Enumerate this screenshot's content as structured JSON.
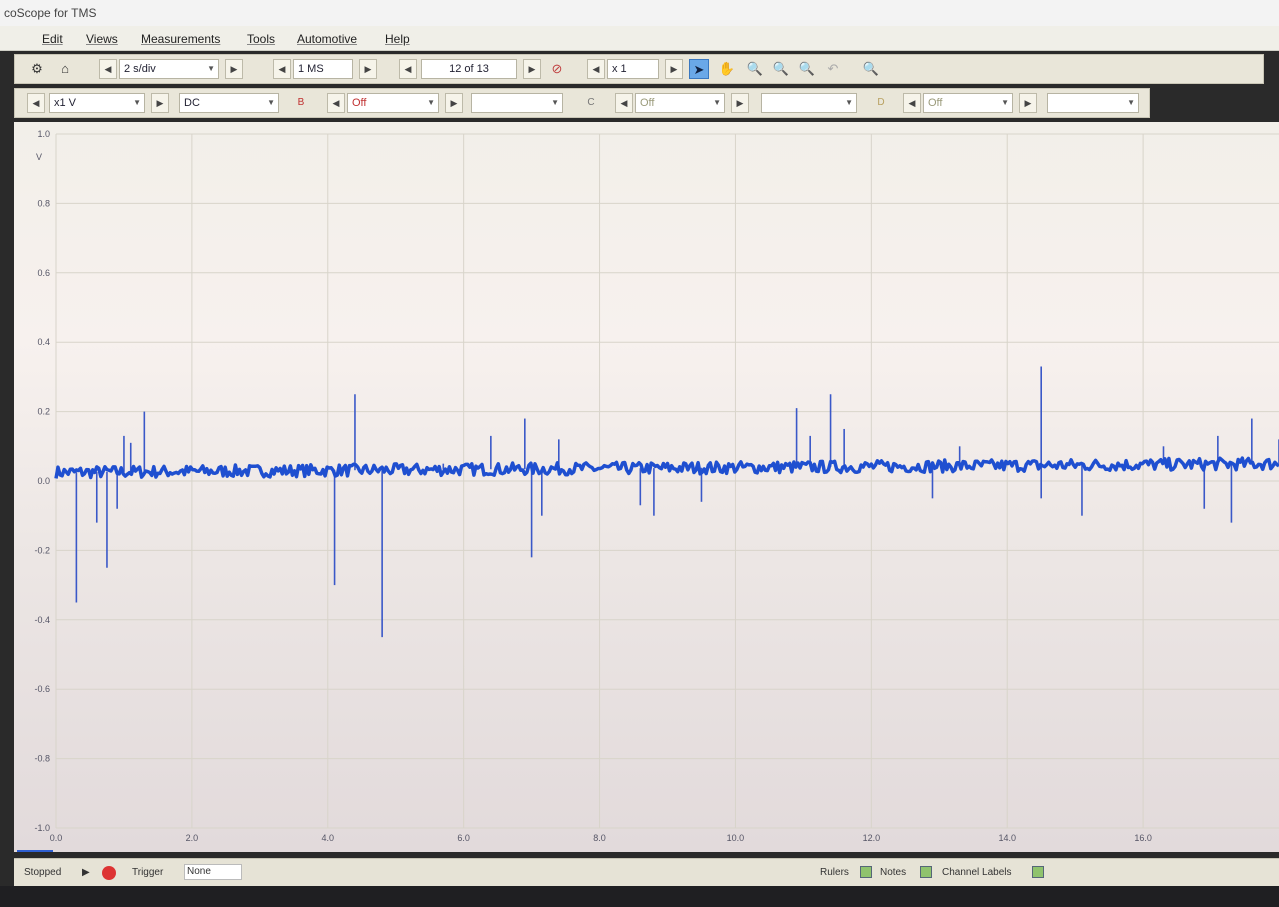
{
  "window": {
    "title": "coScope for TMS"
  },
  "menu": [
    "Edit",
    "Views",
    "Measurements",
    "Tools",
    "Automotive",
    "Help"
  ],
  "toolbar1": {
    "timebase": "2 s/div",
    "samples": "1 MS",
    "buffer": "12 of 13",
    "zoom": "x 1"
  },
  "toolbar2": {
    "range": "x1 V",
    "coupling": "DC",
    "channelB": {
      "label": "B",
      "state": "Off"
    },
    "channelC": {
      "label": "C",
      "state": "Off"
    },
    "channelD": {
      "label": "D",
      "state": "Off"
    }
  },
  "status": {
    "state": "Stopped",
    "trigger_label": "Trigger",
    "trigger_mode": "None",
    "rulers": "Rulers",
    "notes": "Notes",
    "channel_labels": "Channel Labels"
  },
  "chart_data": {
    "type": "line",
    "yunit": "V",
    "ylim": [
      -1.0,
      1.0
    ],
    "xlim": [
      0,
      18
    ],
    "yticks": [
      "1.0",
      "0.8",
      "0.6",
      "0.4",
      "0.2",
      "0.0",
      "-0.2",
      "-0.4",
      "-0.6",
      "-0.8",
      "-1.0"
    ],
    "xticks": [
      "0.0",
      "2.0",
      "4.0",
      "6.0",
      "8.0",
      "10.0",
      "12.0",
      "14.0",
      "16.0"
    ],
    "baseline_start": 0.025,
    "baseline_end": 0.05,
    "spikes": [
      {
        "x": 0.3,
        "y": -0.35
      },
      {
        "x": 0.6,
        "y": -0.12
      },
      {
        "x": 0.75,
        "y": -0.25
      },
      {
        "x": 0.9,
        "y": -0.08
      },
      {
        "x": 1.0,
        "y": 0.13
      },
      {
        "x": 1.1,
        "y": 0.11
      },
      {
        "x": 1.3,
        "y": 0.2
      },
      {
        "x": 4.1,
        "y": -0.3
      },
      {
        "x": 4.4,
        "y": 0.25
      },
      {
        "x": 4.8,
        "y": -0.45
      },
      {
        "x": 5.7,
        "y": 0.05
      },
      {
        "x": 6.4,
        "y": 0.13
      },
      {
        "x": 6.9,
        "y": 0.18
      },
      {
        "x": 7.0,
        "y": -0.22
      },
      {
        "x": 7.15,
        "y": -0.1
      },
      {
        "x": 7.4,
        "y": 0.12
      },
      {
        "x": 8.6,
        "y": -0.07
      },
      {
        "x": 8.8,
        "y": -0.1
      },
      {
        "x": 9.5,
        "y": -0.06
      },
      {
        "x": 10.9,
        "y": 0.21
      },
      {
        "x": 11.1,
        "y": 0.13
      },
      {
        "x": 11.4,
        "y": 0.25
      },
      {
        "x": 11.6,
        "y": 0.15
      },
      {
        "x": 12.9,
        "y": -0.05
      },
      {
        "x": 13.3,
        "y": 0.1
      },
      {
        "x": 14.5,
        "y": 0.33
      },
      {
        "x": 14.5,
        "y": -0.05
      },
      {
        "x": 15.1,
        "y": -0.1
      },
      {
        "x": 16.3,
        "y": 0.1
      },
      {
        "x": 16.9,
        "y": -0.08
      },
      {
        "x": 17.1,
        "y": 0.13
      },
      {
        "x": 17.3,
        "y": -0.12
      },
      {
        "x": 17.6,
        "y": 0.18
      },
      {
        "x": 18.0,
        "y": 0.12
      }
    ]
  }
}
